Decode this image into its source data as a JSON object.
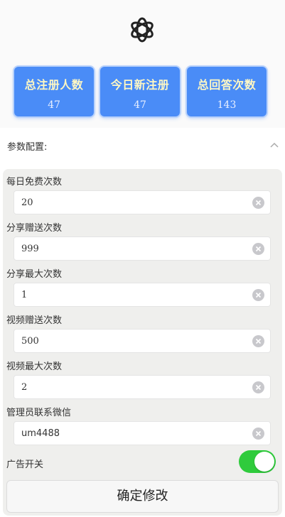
{
  "logo": {
    "icon": "openai-logo-icon"
  },
  "stats": [
    {
      "title": "总注册人数",
      "value": "47"
    },
    {
      "title": "今日新注册",
      "value": "47"
    },
    {
      "title": "总回答次数",
      "value": "143"
    }
  ],
  "section": {
    "title": "参数配置:",
    "icon": "chevron-up-icon"
  },
  "fields": [
    {
      "label": "每日免费次数",
      "value": "20"
    },
    {
      "label": "分享赠送次数",
      "value": "999"
    },
    {
      "label": "分享最大次数",
      "value": "1"
    },
    {
      "label": "视频赠送次数",
      "value": "500"
    },
    {
      "label": "视频最大次数",
      "value": "2"
    },
    {
      "label": "管理员联系微信",
      "value": "um4488"
    }
  ],
  "ad_toggle": {
    "label": "广告开关",
    "on": true
  },
  "submit": {
    "label": "确定修改"
  },
  "colors": {
    "stat_bg": "#4a8cf7",
    "stat_title": "#fdf7c4",
    "toggle_on": "#2fcb3c",
    "panel_bg": "#efefed"
  }
}
